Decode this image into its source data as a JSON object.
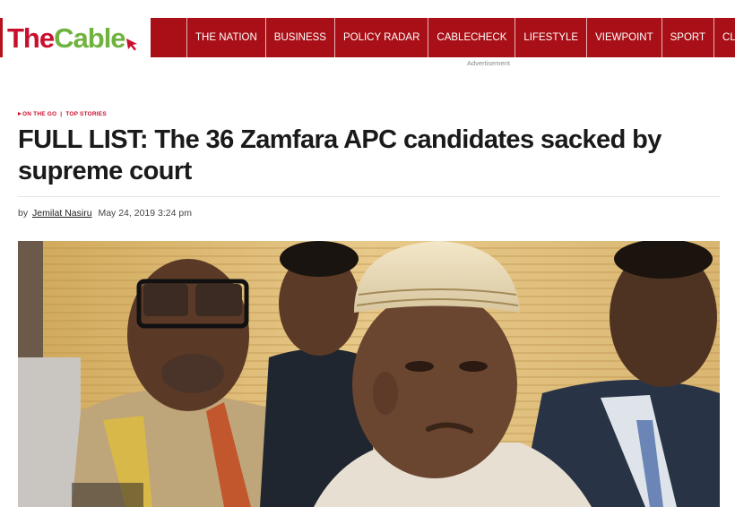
{
  "logo": {
    "part1": "The",
    "part2": "Cable"
  },
  "nav": {
    "items": [
      {
        "label": "THE NATION"
      },
      {
        "label": "BUSINESS"
      },
      {
        "label": "POLICY RADAR"
      },
      {
        "label": "CABLECHECK"
      },
      {
        "label": "LIFESTYLE"
      },
      {
        "label": "VIEWPOINT"
      },
      {
        "label": "SPORT"
      },
      {
        "label": "CLIMAT"
      }
    ]
  },
  "ad_label": "Advertisement",
  "article": {
    "tags": [
      "ON THE GO",
      "TOP STORIES"
    ],
    "title": "FULL LIST: The 36 Zamfara APC candidates sacked by supreme court",
    "byline": {
      "prefix": "by",
      "author": "Jemilat Nasiru",
      "date": "May 24, 2019 3:24 pm"
    }
  },
  "colors": {
    "brand_red": "#a80f16",
    "logo_red": "#c8102e",
    "logo_green": "#6fb33e"
  }
}
